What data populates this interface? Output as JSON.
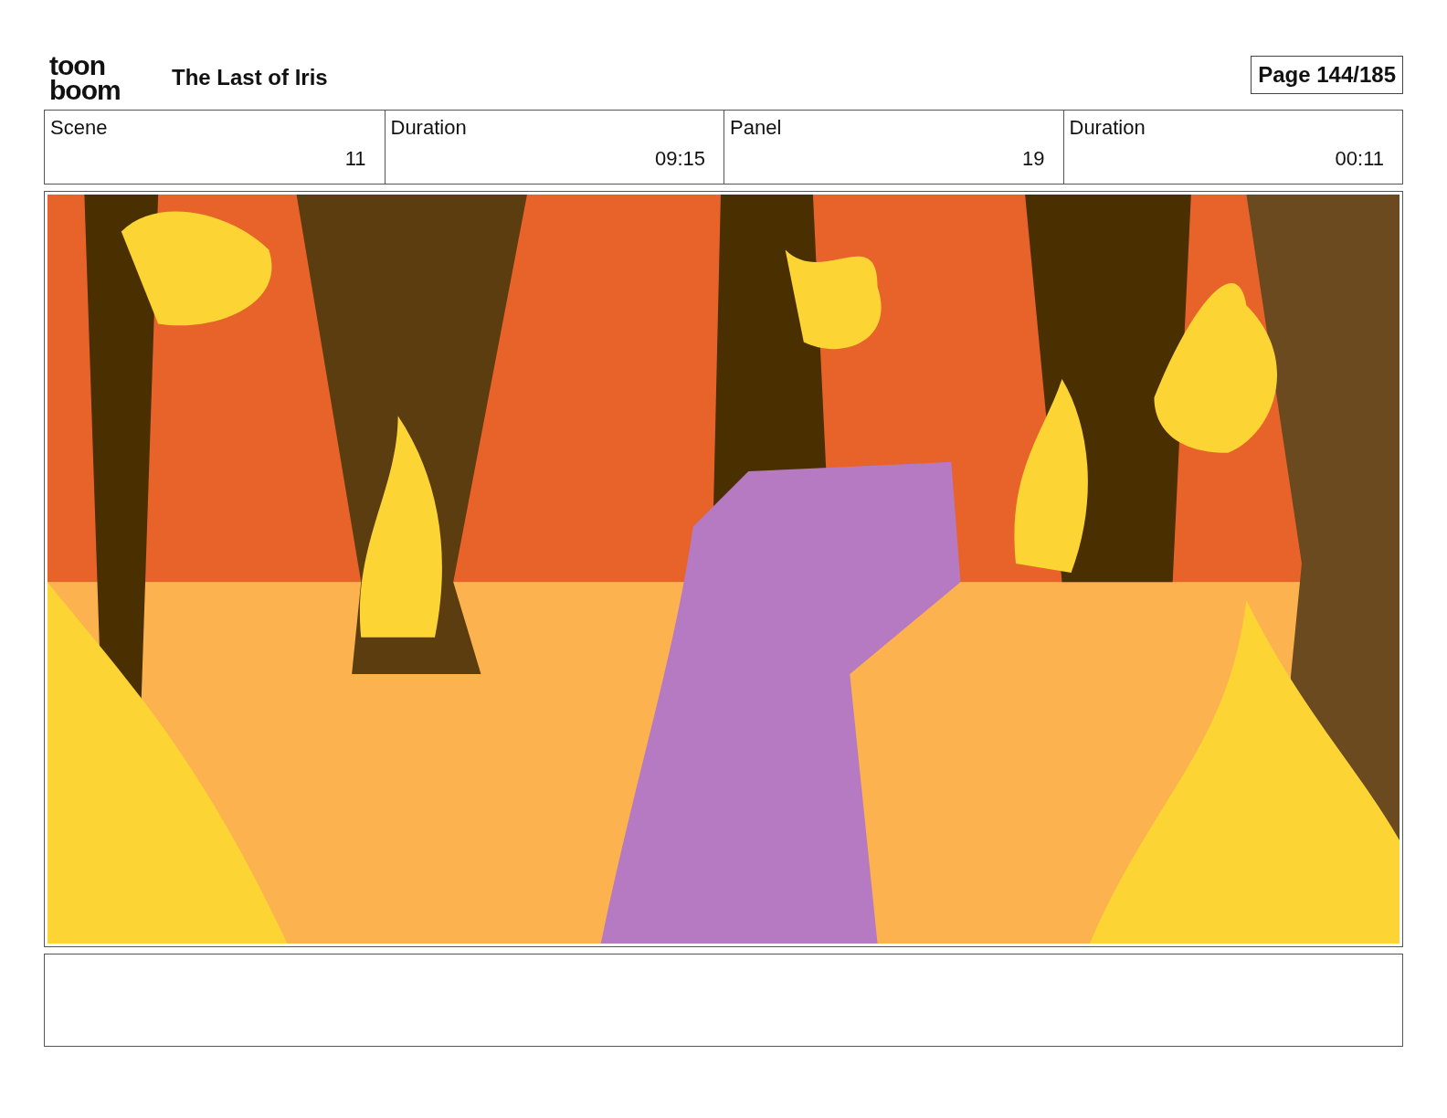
{
  "header": {
    "logo": [
      "toon",
      "boom"
    ],
    "title": "The Last of Iris",
    "page": "Page 144/185"
  },
  "info": [
    {
      "label": "Scene",
      "value": "11"
    },
    {
      "label": "Duration",
      "value": "09:15"
    },
    {
      "label": "Panel",
      "value": "19"
    },
    {
      "label": "Duration",
      "value": "00:11"
    }
  ]
}
